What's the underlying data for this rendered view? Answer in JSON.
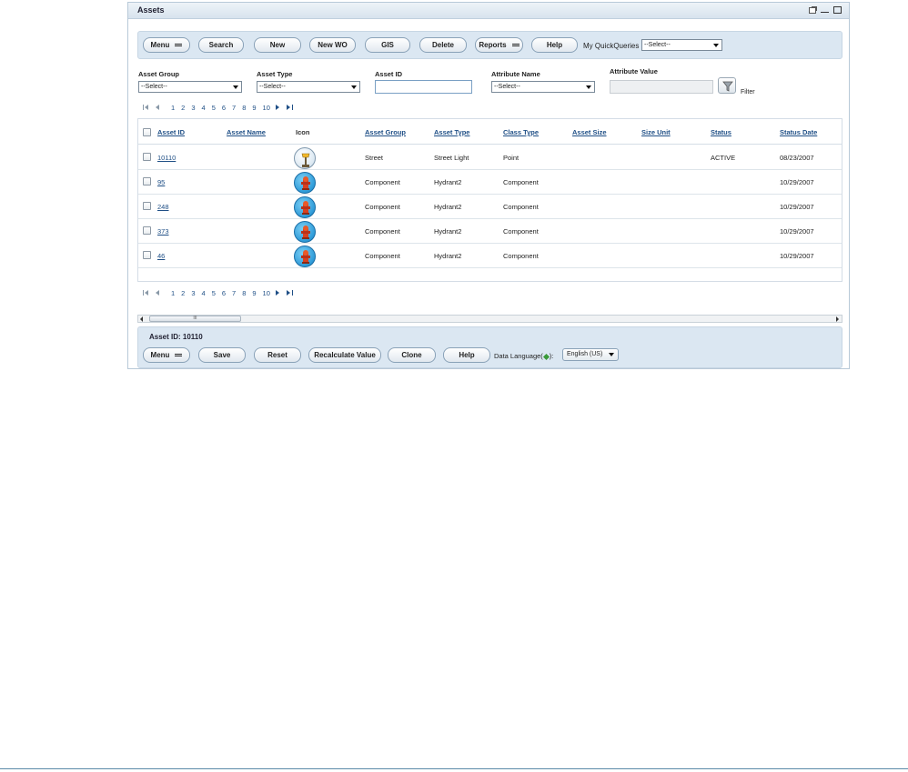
{
  "window": {
    "title": "Assets"
  },
  "toolbar": {
    "buttons": [
      "Menu",
      "Search",
      "New",
      "New WO",
      "GIS",
      "Delete",
      "Reports",
      "Help"
    ],
    "quick_queries_label": "My QuickQueries",
    "quick_queries_value": "--Select--"
  },
  "filters": {
    "asset_group_label": "Asset Group",
    "asset_group_value": "--Select--",
    "asset_type_label": "Asset Type",
    "asset_type_value": "--Select--",
    "asset_id_label": "Asset ID",
    "asset_id_value": "",
    "attribute_name_label": "Attribute Name",
    "attribute_name_value": "--Select--",
    "attribute_value_label": "Attribute Value",
    "attribute_value_value": "",
    "filter_label": "Filter"
  },
  "pager": {
    "pages": [
      "1",
      "2",
      "3",
      "4",
      "5",
      "6",
      "7",
      "8",
      "9",
      "10"
    ]
  },
  "table": {
    "columns": [
      "Asset ID",
      "Asset Name",
      "Icon",
      "Asset Group",
      "Asset Type",
      "Class Type",
      "Asset Size",
      "Size Unit",
      "Status",
      "Status Date"
    ],
    "rows": [
      {
        "asset_id": "10110",
        "asset_name": "",
        "icon": "street-light-icon",
        "asset_group": "Street",
        "asset_type": "Street Light",
        "class_type": "Point",
        "asset_size": "",
        "size_unit": "",
        "status": "ACTIVE",
        "status_date": "08/23/2007"
      },
      {
        "asset_id": "95",
        "asset_name": "",
        "icon": "hydrant-icon",
        "asset_group": "Component",
        "asset_type": "Hydrant2",
        "class_type": "Component",
        "asset_size": "",
        "size_unit": "",
        "status": "",
        "status_date": "10/29/2007"
      },
      {
        "asset_id": "248",
        "asset_name": "",
        "icon": "hydrant-icon",
        "asset_group": "Component",
        "asset_type": "Hydrant2",
        "class_type": "Component",
        "asset_size": "",
        "size_unit": "",
        "status": "",
        "status_date": "10/29/2007"
      },
      {
        "asset_id": "373",
        "asset_name": "",
        "icon": "hydrant-icon",
        "asset_group": "Component",
        "asset_type": "Hydrant2",
        "class_type": "Component",
        "asset_size": "",
        "size_unit": "",
        "status": "",
        "status_date": "10/29/2007"
      },
      {
        "asset_id": "46",
        "asset_name": "",
        "icon": "hydrant-icon",
        "asset_group": "Component",
        "asset_type": "Hydrant2",
        "class_type": "Component",
        "asset_size": "",
        "size_unit": "",
        "status": "",
        "status_date": "10/29/2007"
      }
    ]
  },
  "scrollbar": {
    "thumb_label": "III"
  },
  "detail": {
    "title": "Asset ID: 10110",
    "buttons": [
      "Menu",
      "Save",
      "Reset",
      "Recalculate Value",
      "Clone",
      "Help"
    ],
    "language_label_prefix": "Data Language(",
    "language_label_suffix": "):",
    "language_value": "English (US)"
  },
  "colors": {
    "toolbar_bg": "#dbe7f2",
    "link": "#1f4f86"
  }
}
